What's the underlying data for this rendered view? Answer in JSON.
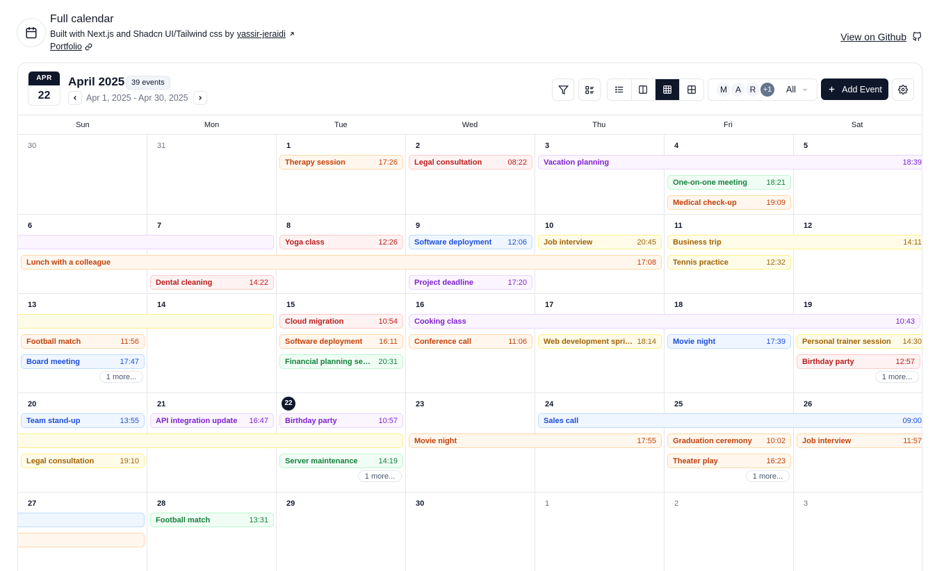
{
  "header": {
    "title": "Full calendar",
    "subtitle_prefix": "Built with Next.js and Shadcn UI/Tailwind css by",
    "author": "yassir-jeraidi",
    "portfolio": "Portfolio",
    "github": "View on Github"
  },
  "toolbar": {
    "badge_month": "APR",
    "badge_day": "22",
    "month_title": "April 2025",
    "events_count": "39 events",
    "range": "Apr 1, 2025 - Apr 30, 2025",
    "users": [
      "M",
      "A",
      "R"
    ],
    "users_more": "+1",
    "user_select": "All",
    "add_event": "Add Event"
  },
  "weekdays": [
    "Sun",
    "Mon",
    "Tue",
    "Wed",
    "Thu",
    "Fri",
    "Sat"
  ],
  "weeks": [
    {
      "days": [
        {
          "n": "30",
          "out": true
        },
        {
          "n": "31",
          "out": true
        },
        {
          "n": "1"
        },
        {
          "n": "2"
        },
        {
          "n": "3"
        },
        {
          "n": "4"
        },
        {
          "n": "5"
        }
      ],
      "events": [
        {
          "name": "Therapy session",
          "time": "17:26",
          "color": "orange",
          "start": 2,
          "span": 1,
          "slot": 0
        },
        {
          "name": "Legal consultation",
          "time": "08:22",
          "color": "red",
          "start": 3,
          "span": 1,
          "slot": 0
        },
        {
          "name": "Vacation planning",
          "time": "18:39",
          "color": "purple",
          "start": 4,
          "span": 3,
          "slot": 0,
          "contRight": true
        },
        {
          "name": "One-on-one meeting",
          "time": "18:21",
          "color": "green",
          "start": 5,
          "span": 1,
          "slot": 1
        },
        {
          "name": "Medical check-up",
          "time": "19:09",
          "color": "orange",
          "start": 5,
          "span": 1,
          "slot": 2
        }
      ],
      "more": []
    },
    {
      "days": [
        {
          "n": "6"
        },
        {
          "n": "7"
        },
        {
          "n": "8"
        },
        {
          "n": "9"
        },
        {
          "n": "10"
        },
        {
          "n": "11"
        },
        {
          "n": "12"
        }
      ],
      "events": [
        {
          "name": "",
          "time": "",
          "color": "purple",
          "start": 0,
          "span": 2,
          "slot": 0,
          "contLeft": true
        },
        {
          "name": "Yoga class",
          "time": "12:26",
          "color": "red",
          "start": 2,
          "span": 1,
          "slot": 0
        },
        {
          "name": "Software deployment",
          "time": "12:06",
          "color": "blue",
          "start": 3,
          "span": 1,
          "slot": 0
        },
        {
          "name": "Job interview",
          "time": "20:45",
          "color": "yellow",
          "start": 4,
          "span": 1,
          "slot": 0
        },
        {
          "name": "Business trip",
          "time": "14:11",
          "color": "yellow",
          "start": 5,
          "span": 2,
          "slot": 0,
          "contRight": true
        },
        {
          "name": "Lunch with a colleague",
          "time": "17:08",
          "color": "orange",
          "start": 0,
          "span": 5,
          "slot": 1
        },
        {
          "name": "Tennis practice",
          "time": "12:32",
          "color": "yellow",
          "start": 5,
          "span": 1,
          "slot": 1
        },
        {
          "name": "Dental cleaning",
          "time": "14:22",
          "color": "red",
          "start": 1,
          "span": 1,
          "slot": 2
        },
        {
          "name": "Project deadline",
          "time": "17:20",
          "color": "purple",
          "start": 3,
          "span": 1,
          "slot": 2
        }
      ],
      "more": []
    },
    {
      "days": [
        {
          "n": "13"
        },
        {
          "n": "14"
        },
        {
          "n": "15"
        },
        {
          "n": "16"
        },
        {
          "n": "17"
        },
        {
          "n": "18"
        },
        {
          "n": "19"
        }
      ],
      "events": [
        {
          "name": "",
          "time": "",
          "color": "yellow",
          "start": 0,
          "span": 2,
          "slot": 0,
          "contLeft": true
        },
        {
          "name": "Cloud migration",
          "time": "10:54",
          "color": "red",
          "start": 2,
          "span": 1,
          "slot": 0
        },
        {
          "name": "Cooking class",
          "time": "10:43",
          "color": "purple",
          "start": 3,
          "span": 4,
          "slot": 0
        },
        {
          "name": "Football match",
          "time": "11:56",
          "color": "orange",
          "start": 0,
          "span": 1,
          "slot": 1
        },
        {
          "name": "Software deployment",
          "time": "16:11",
          "color": "orange",
          "start": 2,
          "span": 1,
          "slot": 1
        },
        {
          "name": "Conference call",
          "time": "11:06",
          "color": "orange",
          "start": 3,
          "span": 1,
          "slot": 1
        },
        {
          "name": "Web development sprint...",
          "time": "18:14",
          "color": "yellow",
          "start": 4,
          "span": 1,
          "slot": 1
        },
        {
          "name": "Movie night",
          "time": "17:39",
          "color": "blue",
          "start": 5,
          "span": 1,
          "slot": 1
        },
        {
          "name": "Personal trainer session",
          "time": "14:30",
          "color": "yellow",
          "start": 6,
          "span": 1,
          "slot": 1,
          "contRight": true
        },
        {
          "name": "Board meeting",
          "time": "17:47",
          "color": "blue",
          "start": 0,
          "span": 1,
          "slot": 2
        },
        {
          "name": "Financial planning session",
          "time": "20:31",
          "color": "green",
          "start": 2,
          "span": 1,
          "slot": 2
        },
        {
          "name": "Birthday party",
          "time": "12:57",
          "color": "red",
          "start": 6,
          "span": 1,
          "slot": 2
        }
      ],
      "more": [
        {
          "col": 0,
          "label": "1 more..."
        },
        {
          "col": 6,
          "label": "1 more..."
        }
      ]
    },
    {
      "days": [
        {
          "n": "20"
        },
        {
          "n": "21"
        },
        {
          "n": "22",
          "today": true
        },
        {
          "n": "23"
        },
        {
          "n": "24"
        },
        {
          "n": "25"
        },
        {
          "n": "26"
        }
      ],
      "events": [
        {
          "name": "Team stand-up",
          "time": "13:55",
          "color": "blue",
          "start": 0,
          "span": 1,
          "slot": 0
        },
        {
          "name": "API integration update",
          "time": "16:47",
          "color": "purple",
          "start": 1,
          "span": 1,
          "slot": 0
        },
        {
          "name": "Birthday party",
          "time": "10:57",
          "color": "purple",
          "start": 2,
          "span": 1,
          "slot": 0
        },
        {
          "name": "Sales call",
          "time": "09:00",
          "color": "blue",
          "start": 4,
          "span": 3,
          "slot": 0,
          "contRight": true
        },
        {
          "name": "",
          "time": "",
          "color": "yellow",
          "start": 0,
          "span": 3,
          "slot": 1,
          "contLeft": true
        },
        {
          "name": "Movie night",
          "time": "17:55",
          "color": "orange",
          "start": 3,
          "span": 2,
          "slot": 1
        },
        {
          "name": "Graduation ceremony",
          "time": "10:02",
          "color": "orange",
          "start": 5,
          "span": 1,
          "slot": 1
        },
        {
          "name": "Job interview",
          "time": "11:57",
          "color": "orange",
          "start": 6,
          "span": 1,
          "slot": 1,
          "contRight": true
        },
        {
          "name": "Legal consultation",
          "time": "19:10",
          "color": "yellow",
          "start": 0,
          "span": 1,
          "slot": 2
        },
        {
          "name": "Server maintenance",
          "time": "14:19",
          "color": "green",
          "start": 2,
          "span": 1,
          "slot": 2
        },
        {
          "name": "Theater play",
          "time": "16:23",
          "color": "orange",
          "start": 5,
          "span": 1,
          "slot": 2
        }
      ],
      "more": [
        {
          "col": 2,
          "label": "1 more..."
        },
        {
          "col": 5,
          "label": "1 more..."
        }
      ]
    },
    {
      "days": [
        {
          "n": "27"
        },
        {
          "n": "28"
        },
        {
          "n": "29"
        },
        {
          "n": "30"
        },
        {
          "n": "1",
          "out": true
        },
        {
          "n": "2",
          "out": true
        },
        {
          "n": "3",
          "out": true
        }
      ],
      "events": [
        {
          "name": "",
          "time": "",
          "color": "blue",
          "start": 0,
          "span": 1,
          "slot": 0,
          "contLeft": true
        },
        {
          "name": "Football match",
          "time": "13:31",
          "color": "green",
          "start": 1,
          "span": 1,
          "slot": 0
        },
        {
          "name": "",
          "time": "",
          "color": "orange",
          "start": 0,
          "span": 1,
          "slot": 1,
          "contLeft": true
        }
      ],
      "more": []
    }
  ]
}
